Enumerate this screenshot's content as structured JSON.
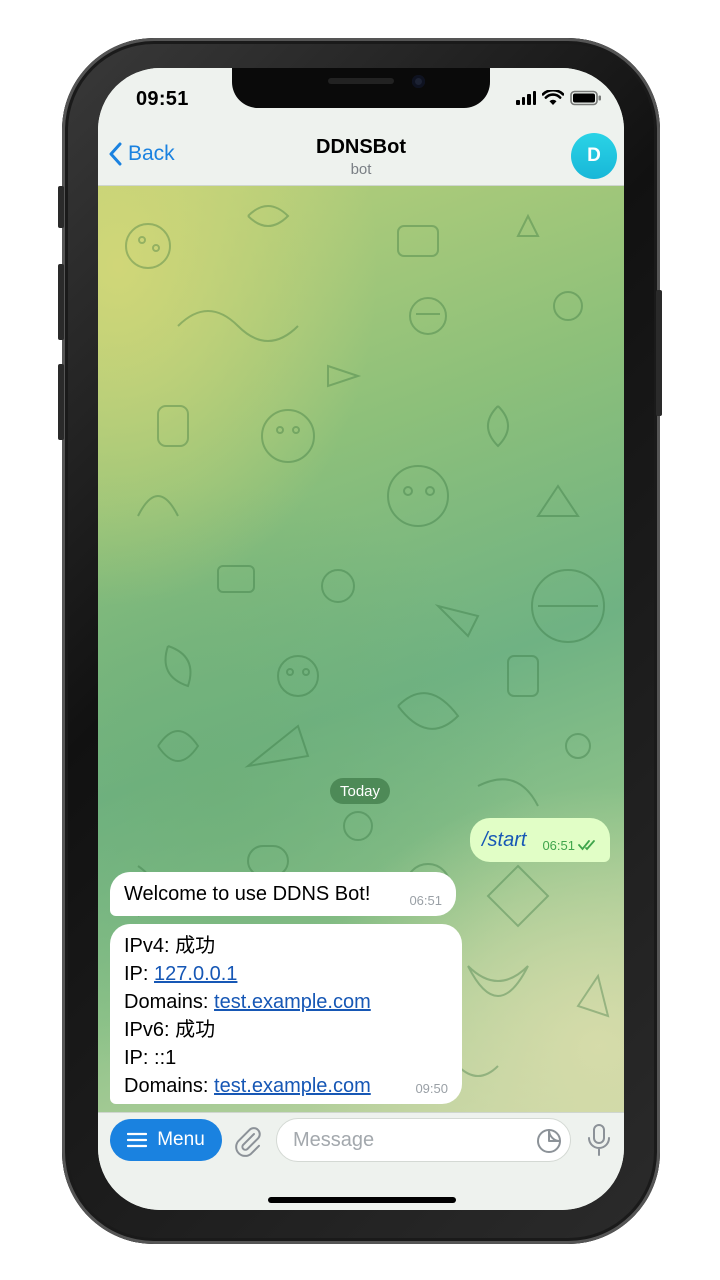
{
  "status_bar": {
    "time": "09:51"
  },
  "nav": {
    "back_label": "Back",
    "title": "DDNSBot",
    "subtitle": "bot",
    "avatar_letter": "D"
  },
  "chat": {
    "date_label": "Today",
    "outgoing": {
      "text": "/start",
      "time": "06:51"
    },
    "incoming": [
      {
        "lines": [
          "Welcome to use DDNS Bot!"
        ],
        "time": "06:51"
      },
      {
        "time": "09:50",
        "ipv4_label": "IPv4: ",
        "ipv4_status": "成功",
        "ip4_label": "IP: ",
        "ip4_value": "127.0.0.1",
        "domains4_label": "Domains: ",
        "domains4_value": "test.example.com",
        "ipv6_label": "IPv6: ",
        "ipv6_status": "成功",
        "ip6_label": "IP: ",
        "ip6_value": "::1",
        "domains6_label": "Domains: ",
        "domains6_value": "test.example.com"
      }
    ]
  },
  "input_bar": {
    "menu_label": "Menu",
    "placeholder": "Message"
  },
  "colors": {
    "accent": "#1a82e0",
    "outgoing_bubble": "#e1fec6",
    "link": "#1657b5",
    "read_check": "#3fa54b"
  }
}
